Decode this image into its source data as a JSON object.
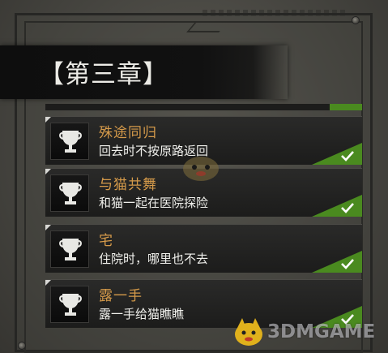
{
  "chapter": {
    "title": "【第三章】"
  },
  "achievements": [
    {
      "name": "殊途同归",
      "description": "回去时不按原路返回",
      "completed": true,
      "icon": "trophy-icon"
    },
    {
      "name": "与猫共舞",
      "description": "和猫一起在医院探险",
      "completed": true,
      "icon": "trophy-icon"
    },
    {
      "name": "宅",
      "description": "住院时，哪里也不去",
      "completed": true,
      "icon": "trophy-icon"
    },
    {
      "name": "露一手",
      "description": "露一手给猫瞧瞧",
      "completed": true,
      "icon": "trophy-icon"
    }
  ],
  "watermark": {
    "text": "3DMGAME"
  },
  "colors": {
    "achievement_name": "#d59a4a",
    "description": "#f0f0ec",
    "completed_check_bg": "#4a8a1f",
    "banner_bg": "#0e0e0e"
  }
}
